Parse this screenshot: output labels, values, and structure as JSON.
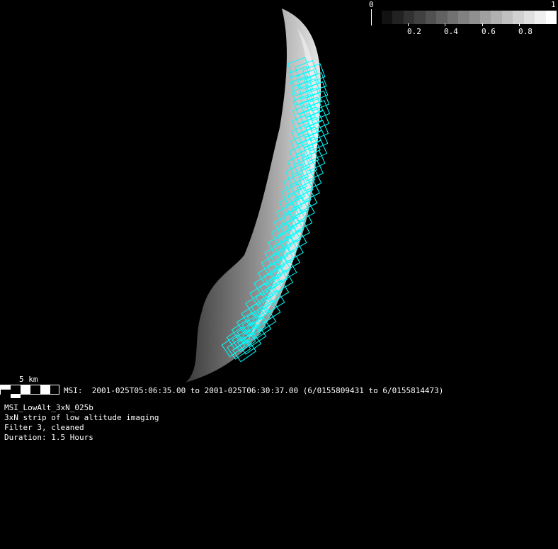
{
  "colorbar": {
    "min_label": "0",
    "max_label": "1",
    "tick_labels": [
      "0.2",
      "0.4",
      "0.6",
      "0.8"
    ],
    "steps": 16
  },
  "scale": {
    "label": "5 km"
  },
  "observation": {
    "line": "MSI:  2001-025T05:06:35.00 to 2001-025T06:30:37.00 (6/0155809431 to 6/0155814473)"
  },
  "info": {
    "name": "MSI_LowAlt_3xN_025b",
    "description": "3xN strip of low altitude imaging",
    "filter": "Filter 3, cleaned",
    "duration": "Duration: 1.5 Hours"
  },
  "colors": {
    "footprint": "#00ffff",
    "background": "#000000"
  }
}
